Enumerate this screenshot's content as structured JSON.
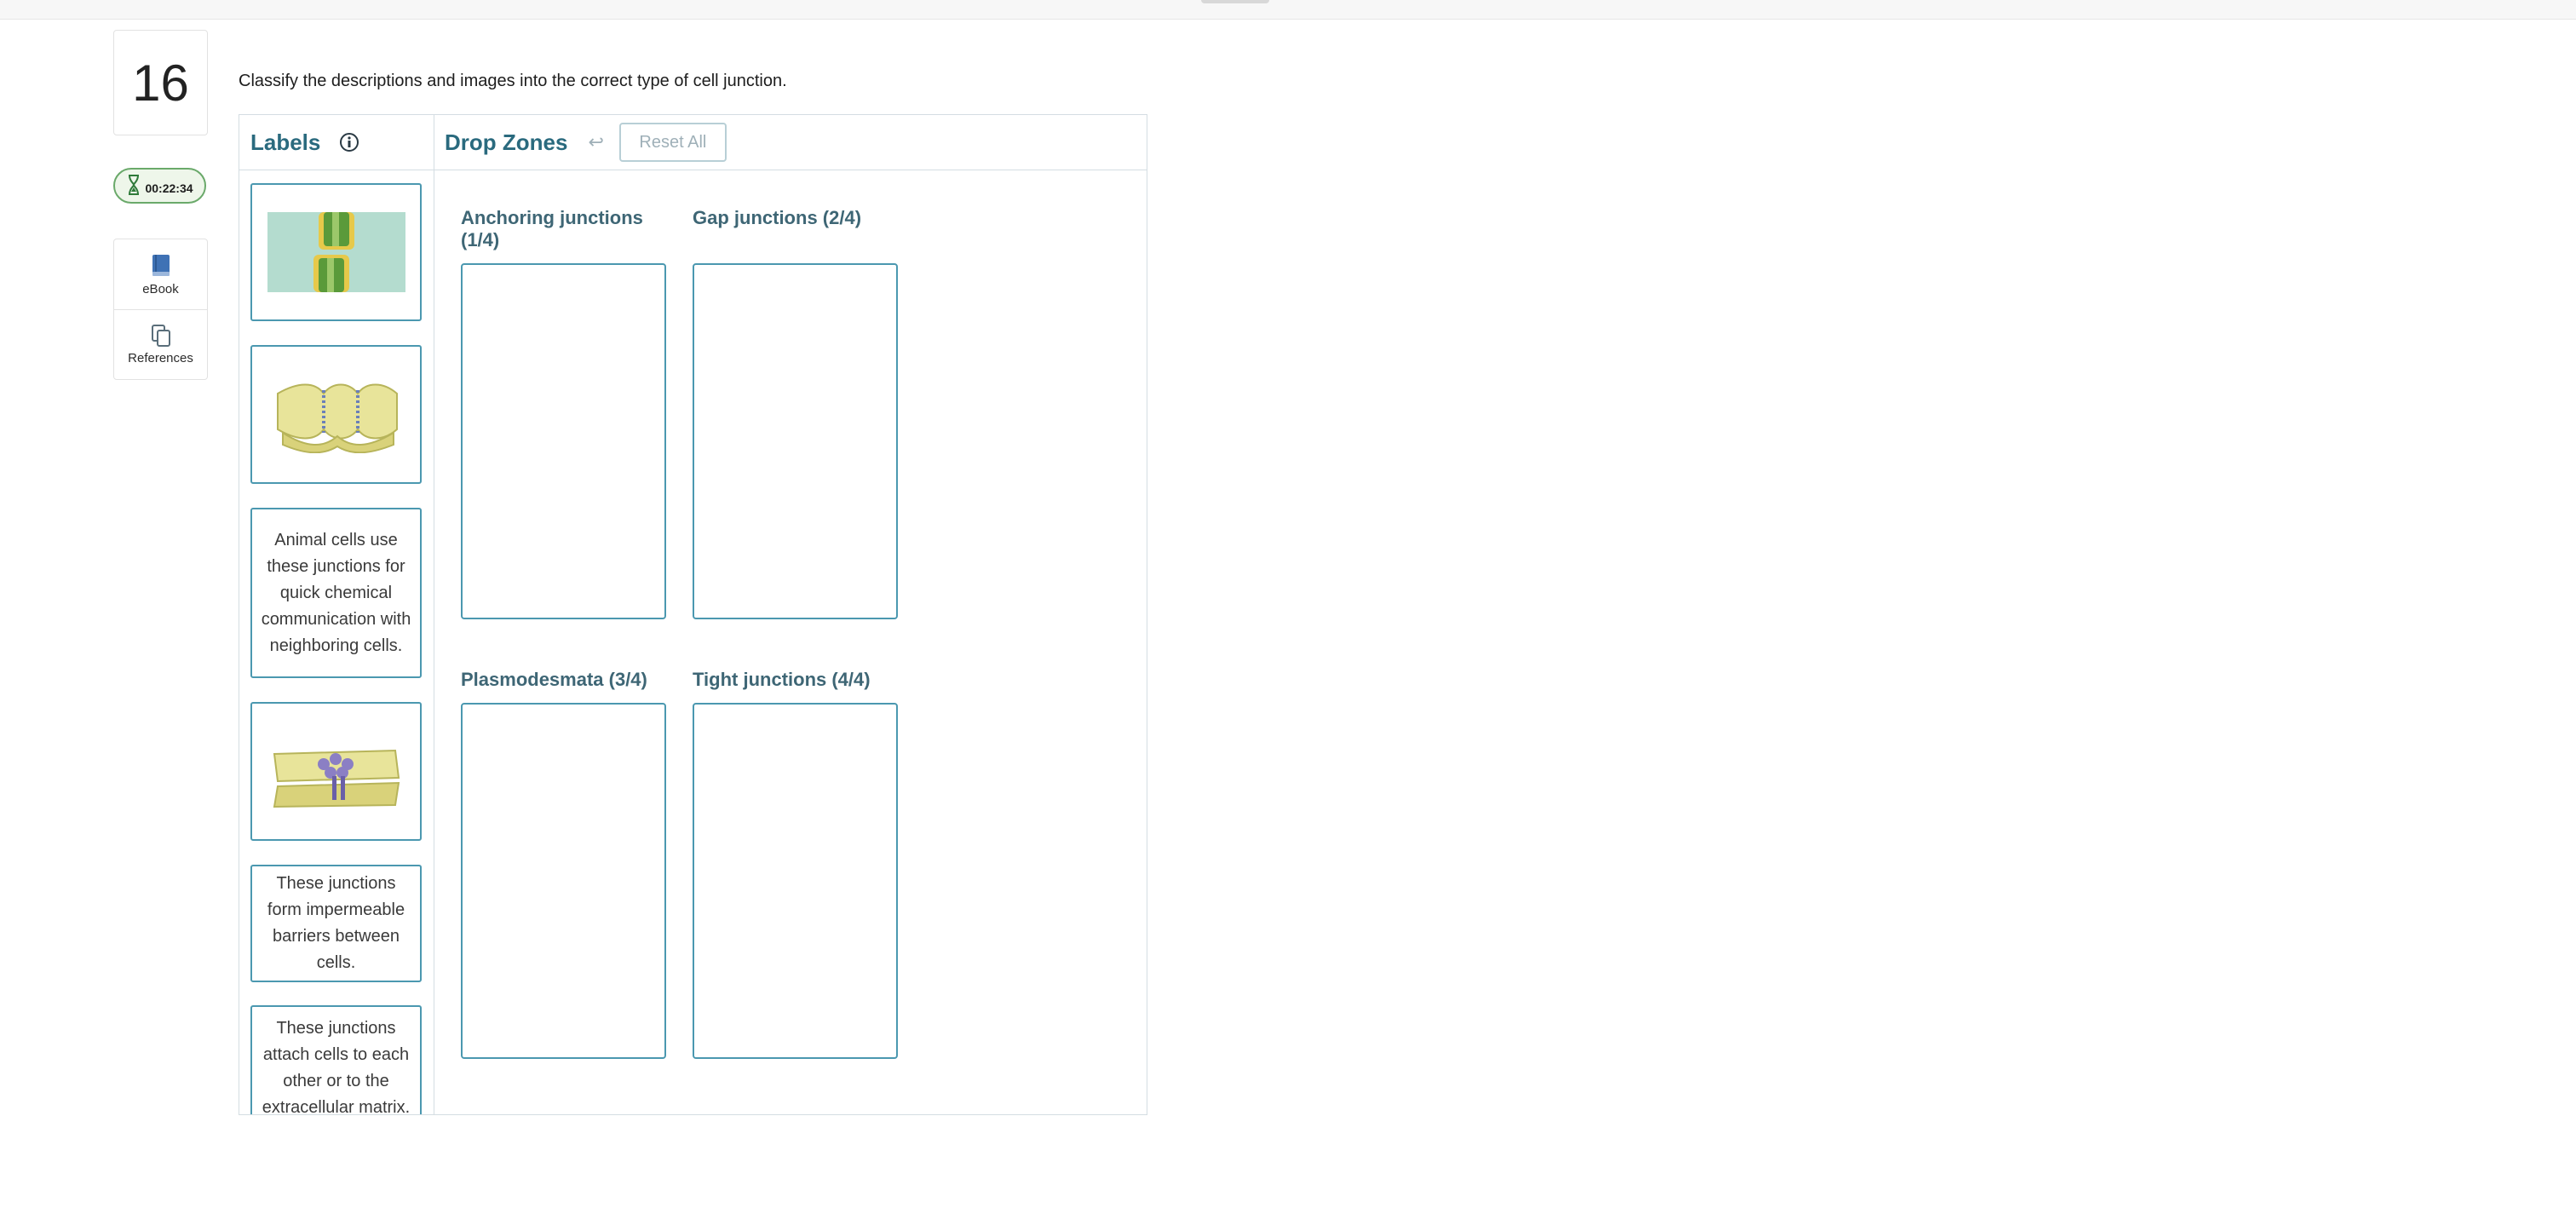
{
  "question": {
    "number": "16",
    "timer": "00:22:34",
    "prompt": "Classify the descriptions and images into the correct type of cell junction."
  },
  "tools": [
    {
      "label": "eBook",
      "icon": "book-icon"
    },
    {
      "label": "References",
      "icon": "copy-icon"
    }
  ],
  "labels_panel": {
    "title": "Labels",
    "info_icon": "info-icon",
    "items": [
      {
        "type": "image",
        "icon": "tight-junction-image"
      },
      {
        "type": "image",
        "icon": "anchoring-junction-image"
      },
      {
        "type": "text",
        "text": "Animal cells use these junctions for quick chemical communication with neighboring cells."
      },
      {
        "type": "image",
        "icon": "gap-junction-image"
      },
      {
        "type": "text",
        "text": "These junctions form impermeable barriers between cells."
      },
      {
        "type": "text",
        "text": "These junctions attach cells to each other or to the extracellular matrix."
      }
    ]
  },
  "drop_panel": {
    "title": "Drop Zones",
    "undo_icon": "undo-icon",
    "reset_label": "Reset All",
    "zones": [
      {
        "title": "Anchoring junctions (1/4)"
      },
      {
        "title": "Gap junctions (2/4)"
      },
      {
        "title": "Plasmodesmata (3/4)"
      },
      {
        "title": "Tight junctions (4/4)"
      }
    ]
  },
  "colors": {
    "accent": "#2a6a7e",
    "card_border": "#4b98b0",
    "timer_border": "#6aa96a"
  }
}
